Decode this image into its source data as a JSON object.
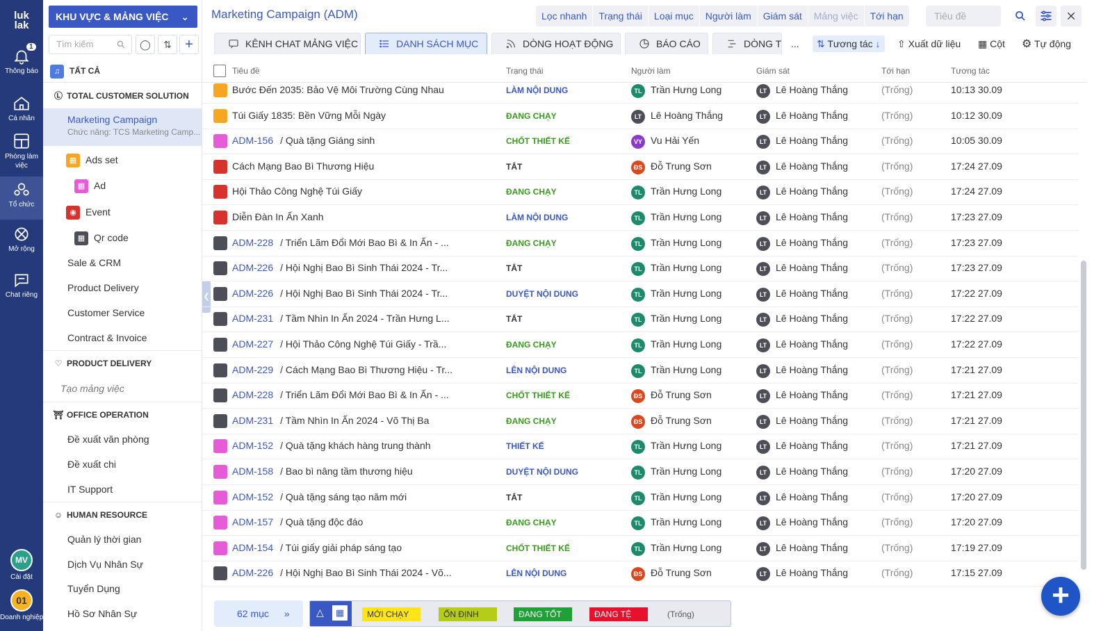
{
  "rail": {
    "logo_line1": "luk",
    "logo_line2": "lak",
    "items": [
      {
        "label": "Thông báo",
        "badge": "1"
      },
      {
        "label": "Cá nhân"
      },
      {
        "label": "Phòng làm việc"
      },
      {
        "label": "Tổ chức"
      },
      {
        "label": "Mở rộng"
      },
      {
        "label": "Chat riêng"
      }
    ],
    "settings_label": "Cài đặt",
    "settings_avatar": "MV",
    "company_label": "Doanh nghiệp",
    "company_avatar": "01"
  },
  "sidebar": {
    "workspace_button": "KHU VỰC & MẢNG VIỆC",
    "search_placeholder": "Tìm kiếm",
    "all_label": "TẤT CẢ",
    "groups": {
      "tcs": "TOTAL CUSTOMER SOLUTION",
      "pd": "PRODUCT DELIVERY",
      "oo": "OFFICE OPERATION",
      "hr": "HUMAN RESOURCE"
    },
    "marketing": {
      "name": "Marketing Campaign",
      "sub": "Chức năng: TCS Marketing Camp..."
    },
    "children": [
      "Ads set",
      "Ad",
      "Event",
      "Qr code"
    ],
    "tcs_items": [
      "Sale & CRM",
      "Product Delivery",
      "Customer Service",
      "Contract & Invoice"
    ],
    "pd_create": "Tạo mảng việc",
    "oo_items": [
      "Đề xuất văn phòng",
      "Đề xuất chi",
      "IT Support"
    ],
    "hr_items": [
      "Quản lý thời gian",
      "Dịch Vụ Nhân Sự",
      "Tuyển Dụng",
      "Hồ Sơ Nhân Sự"
    ]
  },
  "header": {
    "title": "Marketing Campaign (ADM)",
    "filters": [
      "Lọc nhanh",
      "Trạng thái",
      "Loại mục",
      "Người làm",
      "Giám sát",
      "Mảng việc",
      "Tới hạn"
    ],
    "search_placeholder": "Tiêu đề"
  },
  "tabs": [
    "KÊNH CHAT MẢNG VIỆC",
    "DANH SÁCH MỤC",
    "DÒNG HOẠT ĐỘNG",
    "BÁO CÁO",
    "DÒNG T"
  ],
  "toolbar": {
    "more": "...",
    "sort": "Tương tác",
    "export": "Xuất dữ liệu",
    "columns": "Cột",
    "auto": "Tự động"
  },
  "columns": [
    "Tiêu đề",
    "Trạng thái",
    "Người làm",
    "Giám sát",
    "Tới hạn",
    "Tương tác"
  ],
  "rows": [
    {
      "icon": "orange",
      "key": "",
      "title": "Bước Đến 2035: Bảo Vệ Môi Trường Cùng Nhau",
      "status": "LÀM NỘI DUNG",
      "status_color": "#3a58c4",
      "assignee": "Trần Hưng Long",
      "assignee_av": "TL",
      "assignee_type": "tl",
      "supervisor": "Lê Hoàng Thắng",
      "supervisor_av": "LT",
      "due": "(Trống)",
      "updated": "10:13 30.09"
    },
    {
      "icon": "orange",
      "key": "",
      "title": "Túi Giấy 1835: Bền Vững Mỗi Ngày",
      "status": "ĐANG CHẠY",
      "status_color": "#3a9a1d",
      "assignee": "Lê Hoàng Thắng",
      "assignee_av": "LT",
      "assignee_type": "lt",
      "supervisor": "Lê Hoàng Thắng",
      "supervisor_av": "LT",
      "due": "(Trống)",
      "updated": "10:12 30.09"
    },
    {
      "icon": "pink",
      "key": "ADM-156",
      "title": "/  Quà tặng Giáng sinh",
      "status": "CHỐT THIẾT KẾ",
      "status_color": "#3a9a1d",
      "assignee": "Vu Hải Yến",
      "assignee_av": "VY",
      "assignee_type": "vy",
      "supervisor": "Lê Hoàng Thắng",
      "supervisor_av": "LT",
      "due": "(Trống)",
      "updated": "10:05 30.09"
    },
    {
      "icon": "red",
      "key": "",
      "title": "Cách Mạng Bao Bì Thương Hiệu",
      "status": "TẮT",
      "status_color": "#333333",
      "assignee": "Đỗ Trung Sơn",
      "assignee_av": "ĐS",
      "assignee_type": "ds",
      "supervisor": "Lê Hoàng Thắng",
      "supervisor_av": "LT",
      "due": "(Trống)",
      "updated": "17:24 27.09"
    },
    {
      "icon": "red",
      "key": "",
      "title": "Hội Thảo Công Nghệ Túi Giấy",
      "status": "ĐANG CHẠY",
      "status_color": "#3a9a1d",
      "assignee": "Trần Hưng Long",
      "assignee_av": "TL",
      "assignee_type": "tl",
      "supervisor": "Lê Hoàng Thắng",
      "supervisor_av": "LT",
      "due": "(Trống)",
      "updated": "17:24 27.09"
    },
    {
      "icon": "red",
      "key": "",
      "title": "Diễn Đàn In Ấn Xanh",
      "status": "LÀM NỘI DUNG",
      "status_color": "#3a58c4",
      "assignee": "Trần Hưng Long",
      "assignee_av": "TL",
      "assignee_type": "tl",
      "supervisor": "Lê Hoàng Thắng",
      "supervisor_av": "LT",
      "due": "(Trống)",
      "updated": "17:23 27.09"
    },
    {
      "icon": "gray",
      "key": "ADM-228",
      "title": "/  Triển Lãm Đổi Mới Bao Bì & In Ấn - ...",
      "status": "ĐANG CHẠY",
      "status_color": "#3a9a1d",
      "assignee": "Trần Hưng Long",
      "assignee_av": "TL",
      "assignee_type": "tl",
      "supervisor": "Lê Hoàng Thắng",
      "supervisor_av": "LT",
      "due": "(Trống)",
      "updated": "17:23 27.09"
    },
    {
      "icon": "gray",
      "key": "ADM-226",
      "title": "/  Hội Nghị Bao Bì Sinh Thái 2024 - Tr...",
      "status": "TẮT",
      "status_color": "#333333",
      "assignee": "Trần Hưng Long",
      "assignee_av": "TL",
      "assignee_type": "tl",
      "supervisor": "Lê Hoàng Thắng",
      "supervisor_av": "LT",
      "due": "(Trống)",
      "updated": "17:23 27.09"
    },
    {
      "icon": "gray",
      "key": "ADM-226",
      "title": "/  Hội Nghị Bao Bì Sinh Thái 2024 - Tr...",
      "status": "DUYỆT NỘI DUNG",
      "status_color": "#3a58c4",
      "assignee": "Trần Hưng Long",
      "assignee_av": "TL",
      "assignee_type": "tl",
      "supervisor": "Lê Hoàng Thắng",
      "supervisor_av": "LT",
      "due": "(Trống)",
      "updated": "17:22 27.09"
    },
    {
      "icon": "gray",
      "key": "ADM-231",
      "title": "/  Tầm Nhìn In Ấn 2024 - Trần Hưng L...",
      "status": "TẮT",
      "status_color": "#333333",
      "assignee": "Trần Hưng Long",
      "assignee_av": "TL",
      "assignee_type": "tl",
      "supervisor": "Lê Hoàng Thắng",
      "supervisor_av": "LT",
      "due": "(Trống)",
      "updated": "17:22 27.09"
    },
    {
      "icon": "gray",
      "key": "ADM-227",
      "title": "/  Hội Thảo Công Nghệ Túi Giấy - Trầ...",
      "status": "ĐANG CHẠY",
      "status_color": "#3a9a1d",
      "assignee": "Trần Hưng Long",
      "assignee_av": "TL",
      "assignee_type": "tl",
      "supervisor": "Lê Hoàng Thắng",
      "supervisor_av": "LT",
      "due": "(Trống)",
      "updated": "17:22 27.09"
    },
    {
      "icon": "gray",
      "key": "ADM-229",
      "title": "/  Cách Mạng Bao Bì Thương Hiệu - Tr...",
      "status": "LÊN NỘI DUNG",
      "status_color": "#3a58c4",
      "assignee": "Trần Hưng Long",
      "assignee_av": "TL",
      "assignee_type": "tl",
      "supervisor": "Lê Hoàng Thắng",
      "supervisor_av": "LT",
      "due": "(Trống)",
      "updated": "17:21 27.09"
    },
    {
      "icon": "gray",
      "key": "ADM-228",
      "title": "/  Triển Lãm Đổi Mới Bao Bì & In Ấn - ...",
      "status": "CHỐT THIẾT KẾ",
      "status_color": "#3a9a1d",
      "assignee": "Đỗ Trung Sơn",
      "assignee_av": "ĐS",
      "assignee_type": "ds",
      "supervisor": "Lê Hoàng Thắng",
      "supervisor_av": "LT",
      "due": "(Trống)",
      "updated": "17:21 27.09"
    },
    {
      "icon": "gray",
      "key": "ADM-231",
      "title": "/  Tầm Nhìn In Ấn 2024 - Võ Thị Ba",
      "status": "ĐANG CHẠY",
      "status_color": "#3a9a1d",
      "assignee": "Đỗ Trung Sơn",
      "assignee_av": "ĐS",
      "assignee_type": "ds",
      "supervisor": "Lê Hoàng Thắng",
      "supervisor_av": "LT",
      "due": "(Trống)",
      "updated": "17:21 27.09"
    },
    {
      "icon": "pink",
      "key": "ADM-152",
      "title": "/  Quà tặng khách hàng trung thành",
      "status": "THIẾT KẾ",
      "status_color": "#3a58c4",
      "assignee": "Trần Hưng Long",
      "assignee_av": "TL",
      "assignee_type": "tl",
      "supervisor": "Lê Hoàng Thắng",
      "supervisor_av": "LT",
      "due": "(Trống)",
      "updated": "17:21 27.09"
    },
    {
      "icon": "pink",
      "key": "ADM-158",
      "title": "/  Bao bì nâng tầm thương hiệu",
      "status": "DUYỆT NỘI DUNG",
      "status_color": "#3a58c4",
      "assignee": "Trần Hưng Long",
      "assignee_av": "TL",
      "assignee_type": "tl",
      "supervisor": "Lê Hoàng Thắng",
      "supervisor_av": "LT",
      "due": "(Trống)",
      "updated": "17:20 27.09"
    },
    {
      "icon": "pink",
      "key": "ADM-152",
      "title": "/  Quà tặng sáng tạo năm mới",
      "status": "TẮT",
      "status_color": "#333333",
      "assignee": "Trần Hưng Long",
      "assignee_av": "TL",
      "assignee_type": "tl",
      "supervisor": "Lê Hoàng Thắng",
      "supervisor_av": "LT",
      "due": "(Trống)",
      "updated": "17:20 27.09"
    },
    {
      "icon": "pink",
      "key": "ADM-157",
      "title": "/  Quà tặng độc đáo",
      "status": "ĐANG CHẠY",
      "status_color": "#3a9a1d",
      "assignee": "Trần Hưng Long",
      "assignee_av": "TL",
      "assignee_type": "tl",
      "supervisor": "Lê Hoàng Thắng",
      "supervisor_av": "LT",
      "due": "(Trống)",
      "updated": "17:20 27.09"
    },
    {
      "icon": "pink",
      "key": "ADM-154",
      "title": "/  Túi giấy giải pháp sáng tạo",
      "status": "CHỐT THIẾT KẾ",
      "status_color": "#3a9a1d",
      "assignee": "Trần Hưng Long",
      "assignee_av": "TL",
      "assignee_type": "tl",
      "supervisor": "Lê Hoàng Thắng",
      "supervisor_av": "LT",
      "due": "(Trống)",
      "updated": "17:19 27.09"
    },
    {
      "icon": "gray",
      "key": "ADM-226",
      "title": "/  Hội Nghị Bao Bì Sinh Thái 2024 - Võ...",
      "status": "LÊN NỘI DUNG",
      "status_color": "#3a58c4",
      "assignee": "Đỗ Trung Sơn",
      "assignee_av": "ĐS",
      "assignee_type": "ds",
      "supervisor": "Lê Hoàng Thắng",
      "supervisor_av": "LT",
      "due": "(Trống)",
      "updated": "17:15 27.09"
    }
  ],
  "footer": {
    "count": "62 mục",
    "legend": [
      {
        "label": "MỚI CHẠY",
        "bg": "#ffe41a",
        "fg": "#333333"
      },
      {
        "label": "ỔN ĐỊNH",
        "bg": "#b5cc18",
        "fg": "#333333"
      },
      {
        "label": "ĐANG TỐT",
        "bg": "#21a038",
        "fg": "#ffffff"
      },
      {
        "label": "ĐANG TỆ",
        "bg": "#e8112d",
        "fg": "#ffffff"
      },
      {
        "label": "(Trống)",
        "bg": "transparent",
        "fg": "#555555"
      }
    ]
  },
  "colors": {
    "brand": "#3a58c4",
    "rail": "#243a7b"
  }
}
